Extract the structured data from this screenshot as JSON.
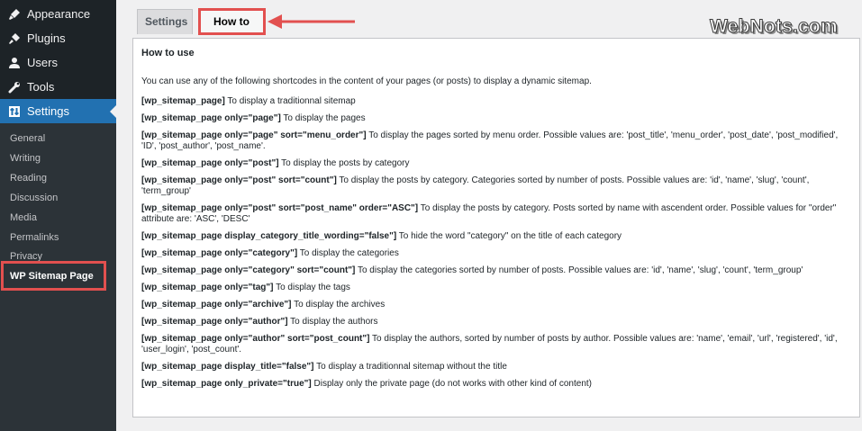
{
  "sidebar": {
    "menu": [
      {
        "label": "Appearance",
        "icon": "paintbrush-icon"
      },
      {
        "label": "Plugins",
        "icon": "plugin-icon"
      },
      {
        "label": "Users",
        "icon": "users-icon"
      },
      {
        "label": "Tools",
        "icon": "wrench-icon"
      },
      {
        "label": "Settings",
        "icon": "settings-icon"
      }
    ],
    "submenu": [
      "General",
      "Writing",
      "Reading",
      "Discussion",
      "Media",
      "Permalinks",
      "Privacy",
      "WP Sitemap Page"
    ]
  },
  "tabs": {
    "settings": "Settings",
    "howto": "How to use"
  },
  "panel": {
    "title": "How to use",
    "intro": "You can use any of the following shortcodes in the content of your pages (or posts) to display a dynamic sitemap.",
    "items": [
      {
        "code": "[wp_sitemap_page]",
        "desc": " To display a traditionnal sitemap"
      },
      {
        "code": "[wp_sitemap_page only=\"page\"]",
        "desc": " To display the pages"
      },
      {
        "code": "[wp_sitemap_page only=\"page\" sort=\"menu_order\"]",
        "desc": " To display the pages sorted by menu order. Possible values are: 'post_title', 'menu_order', 'post_date', 'post_modified', 'ID', 'post_author', 'post_name'."
      },
      {
        "code": "[wp_sitemap_page only=\"post\"]",
        "desc": " To display the posts by category"
      },
      {
        "code": "[wp_sitemap_page only=\"post\" sort=\"count\"]",
        "desc": " To display the posts by category. Categories sorted by number of posts. Possible values are: 'id', 'name', 'slug', 'count', 'term_group'"
      },
      {
        "code": "[wp_sitemap_page only=\"post\" sort=\"post_name\" order=\"ASC\"]",
        "desc": " To display the posts by category. Posts sorted by name with ascendent order. Possible values for \"order\" attribute are: 'ASC', 'DESC'"
      },
      {
        "code": "[wp_sitemap_page display_category_title_wording=\"false\"]",
        "desc": " To hide the word \"category\" on the title of each category"
      },
      {
        "code": "[wp_sitemap_page only=\"category\"]",
        "desc": " To display the categories"
      },
      {
        "code": "[wp_sitemap_page only=\"category\" sort=\"count\"]",
        "desc": " To display the categories sorted by number of posts. Possible values are: 'id', 'name', 'slug', 'count', 'term_group'"
      },
      {
        "code": "[wp_sitemap_page only=\"tag\"]",
        "desc": " To display the tags"
      },
      {
        "code": "[wp_sitemap_page only=\"archive\"]",
        "desc": " To display the archives"
      },
      {
        "code": "[wp_sitemap_page only=\"author\"]",
        "desc": " To display the authors"
      },
      {
        "code": "[wp_sitemap_page only=\"author\" sort=\"post_count\"]",
        "desc": " To display the authors, sorted by number of posts by author. Possible values are: 'name', 'email', 'url', 'registered', 'id', 'user_login', 'post_count'."
      },
      {
        "code": "[wp_sitemap_page display_title=\"false\"]",
        "desc": " To display a traditionnal sitemap without the title"
      },
      {
        "code": "[wp_sitemap_page only_private=\"true\"]",
        "desc": " Display only the private page (do not works with other kind of content)"
      }
    ]
  },
  "watermark": "WebNots.com",
  "colors": {
    "highlight": "#e2504f",
    "accent": "#2271b1",
    "sidebar": "#1d2327"
  }
}
